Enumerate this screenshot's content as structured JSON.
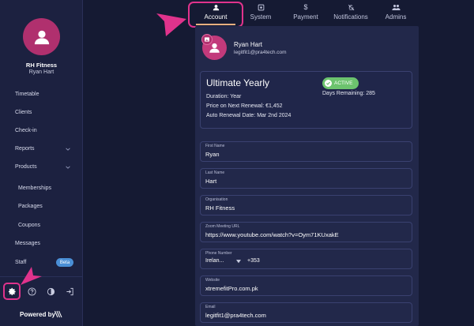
{
  "sidebar": {
    "brand_name": "RH Fitness",
    "user_name": "Ryan Hart",
    "items": [
      {
        "label": "Timetable"
      },
      {
        "label": "Clients"
      },
      {
        "label": "Check-in"
      },
      {
        "label": "Reports"
      },
      {
        "label": "Products"
      },
      {
        "label": "Memberships"
      },
      {
        "label": "Packages"
      },
      {
        "label": "Coupons"
      },
      {
        "label": "Messages"
      },
      {
        "label": "Staff"
      }
    ],
    "beta_badge": "Beta",
    "footer_icons": [
      "gear-icon",
      "help-icon",
      "theme-toggle-icon",
      "logout-icon"
    ],
    "powered_by": "Powered by"
  },
  "tabs": [
    {
      "label": "Account",
      "icon": "person-icon",
      "active": true
    },
    {
      "label": "System",
      "icon": "system-icon",
      "active": false
    },
    {
      "label": "Payment",
      "icon": "dollar-icon",
      "active": false
    },
    {
      "label": "Notifications",
      "icon": "bell-off-icon",
      "active": false
    },
    {
      "label": "Admins",
      "icon": "group-icon",
      "active": false
    }
  ],
  "profile": {
    "name": "Ryan Hart",
    "email": "legitfit1@pra4tech.com"
  },
  "plan": {
    "title": "Ultimate Yearly",
    "duration": "Duration: Year",
    "price": "Price on Next Renewal: €1,452",
    "renewal": "Auto Renewal Date: Mar 2nd 2024",
    "status": "ACTIVE",
    "days_remaining": "Days Remaining: 285"
  },
  "fields": {
    "first_name": {
      "label": "First Name",
      "value": "Ryan"
    },
    "last_name": {
      "label": "Last Name",
      "value": "Hart"
    },
    "organisation": {
      "label": "Organisation",
      "value": "RH Fitness"
    },
    "zoom": {
      "label": "Zoom Meeting URL",
      "value": "https://www.youtube.com/watch?v=Oym71KUxakE"
    },
    "phone": {
      "label": "Phone Number",
      "country": "Irelan...",
      "dial_code": "+353"
    },
    "website": {
      "label": "Website",
      "value": "xtremefitPro.com.pk"
    },
    "email": {
      "label": "Email",
      "value": "legitfit1@pra4tech.com"
    }
  },
  "colors": {
    "accent": "#e0338c",
    "avatar": "#b0306e",
    "active_badge": "#6cc36e",
    "background": "#151a33",
    "panel": "#22284a"
  }
}
